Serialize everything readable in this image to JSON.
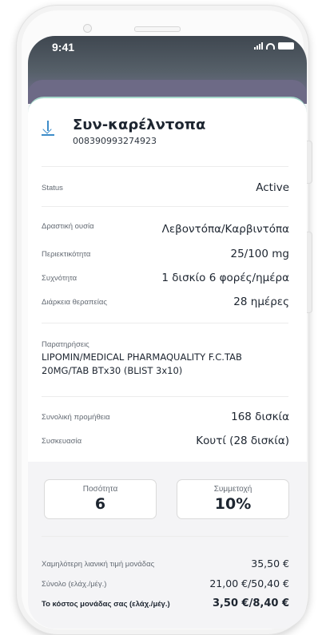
{
  "status_bar": {
    "time": "9:41"
  },
  "medication": {
    "title": "Συν-καρέλντοπα",
    "code": "008390993274923"
  },
  "status": {
    "label": "Status",
    "value": "Active"
  },
  "details": [
    {
      "label": "Δραστική ουσία",
      "value": "Λεβοντόπα/Καρβιντόπα"
    },
    {
      "label": "Περιεκτικότητα",
      "value": "25/100 mg"
    },
    {
      "label": "Συχνότητα",
      "value": "1 δισκίο 6 φορές/ημέρα"
    },
    {
      "label": "Διάρκεια θεραπείας",
      "value": "28 ημέρες"
    }
  ],
  "notes": {
    "label": "Παρατηρήσεις",
    "text": "LIPOMIN/MEDICAL PHARMAQUALITY F.C.TAB 20MG/TAB BTx30 (BLIST 3x10)"
  },
  "supply": [
    {
      "label": "Συνολική προμήθεια",
      "value": "168 δισκία"
    },
    {
      "label": "Συσκευασία",
      "value": "Κουτί (28 δισκία)"
    }
  ],
  "quantity": {
    "label": "Ποσότητα",
    "value": "6"
  },
  "participation": {
    "label": "Συμμετοχή",
    "value": "10%"
  },
  "prices": [
    {
      "label": "Χαμηλότερη λιανική τιμή μονάδας",
      "value": "35,50 €"
    },
    {
      "label": "Σύνολο (ελάχ./μέγ.)",
      "value": "21,00 €/50,40 €"
    },
    {
      "label": "Το κόστος μονάδας σας (ελάχ./μέγ.)",
      "value": "3,50 €/8,40 €"
    }
  ],
  "colors": {
    "accent": "#3d8cc9",
    "header": "#4a525b",
    "card_top_border": "#a7d9cc"
  }
}
